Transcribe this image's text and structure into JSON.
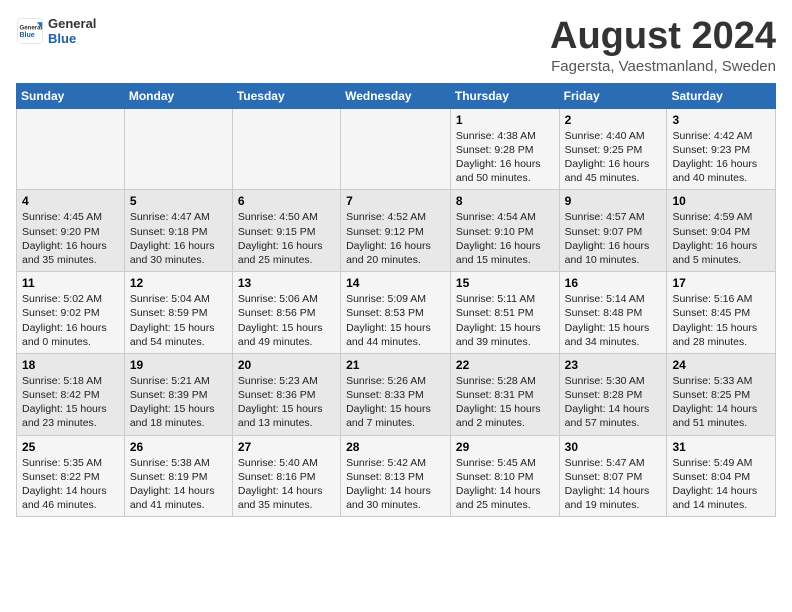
{
  "header": {
    "logo_general": "General",
    "logo_blue": "Blue",
    "title": "August 2024",
    "subtitle": "Fagersta, Vaestmanland, Sweden"
  },
  "days_of_week": [
    "Sunday",
    "Monday",
    "Tuesday",
    "Wednesday",
    "Thursday",
    "Friday",
    "Saturday"
  ],
  "weeks": [
    [
      {
        "day": "",
        "info": ""
      },
      {
        "day": "",
        "info": ""
      },
      {
        "day": "",
        "info": ""
      },
      {
        "day": "",
        "info": ""
      },
      {
        "day": "1",
        "info": "Sunrise: 4:38 AM\nSunset: 9:28 PM\nDaylight: 16 hours\nand 50 minutes."
      },
      {
        "day": "2",
        "info": "Sunrise: 4:40 AM\nSunset: 9:25 PM\nDaylight: 16 hours\nand 45 minutes."
      },
      {
        "day": "3",
        "info": "Sunrise: 4:42 AM\nSunset: 9:23 PM\nDaylight: 16 hours\nand 40 minutes."
      }
    ],
    [
      {
        "day": "4",
        "info": "Sunrise: 4:45 AM\nSunset: 9:20 PM\nDaylight: 16 hours\nand 35 minutes."
      },
      {
        "day": "5",
        "info": "Sunrise: 4:47 AM\nSunset: 9:18 PM\nDaylight: 16 hours\nand 30 minutes."
      },
      {
        "day": "6",
        "info": "Sunrise: 4:50 AM\nSunset: 9:15 PM\nDaylight: 16 hours\nand 25 minutes."
      },
      {
        "day": "7",
        "info": "Sunrise: 4:52 AM\nSunset: 9:12 PM\nDaylight: 16 hours\nand 20 minutes."
      },
      {
        "day": "8",
        "info": "Sunrise: 4:54 AM\nSunset: 9:10 PM\nDaylight: 16 hours\nand 15 minutes."
      },
      {
        "day": "9",
        "info": "Sunrise: 4:57 AM\nSunset: 9:07 PM\nDaylight: 16 hours\nand 10 minutes."
      },
      {
        "day": "10",
        "info": "Sunrise: 4:59 AM\nSunset: 9:04 PM\nDaylight: 16 hours\nand 5 minutes."
      }
    ],
    [
      {
        "day": "11",
        "info": "Sunrise: 5:02 AM\nSunset: 9:02 PM\nDaylight: 16 hours\nand 0 minutes."
      },
      {
        "day": "12",
        "info": "Sunrise: 5:04 AM\nSunset: 8:59 PM\nDaylight: 15 hours\nand 54 minutes."
      },
      {
        "day": "13",
        "info": "Sunrise: 5:06 AM\nSunset: 8:56 PM\nDaylight: 15 hours\nand 49 minutes."
      },
      {
        "day": "14",
        "info": "Sunrise: 5:09 AM\nSunset: 8:53 PM\nDaylight: 15 hours\nand 44 minutes."
      },
      {
        "day": "15",
        "info": "Sunrise: 5:11 AM\nSunset: 8:51 PM\nDaylight: 15 hours\nand 39 minutes."
      },
      {
        "day": "16",
        "info": "Sunrise: 5:14 AM\nSunset: 8:48 PM\nDaylight: 15 hours\nand 34 minutes."
      },
      {
        "day": "17",
        "info": "Sunrise: 5:16 AM\nSunset: 8:45 PM\nDaylight: 15 hours\nand 28 minutes."
      }
    ],
    [
      {
        "day": "18",
        "info": "Sunrise: 5:18 AM\nSunset: 8:42 PM\nDaylight: 15 hours\nand 23 minutes."
      },
      {
        "day": "19",
        "info": "Sunrise: 5:21 AM\nSunset: 8:39 PM\nDaylight: 15 hours\nand 18 minutes."
      },
      {
        "day": "20",
        "info": "Sunrise: 5:23 AM\nSunset: 8:36 PM\nDaylight: 15 hours\nand 13 minutes."
      },
      {
        "day": "21",
        "info": "Sunrise: 5:26 AM\nSunset: 8:33 PM\nDaylight: 15 hours\nand 7 minutes."
      },
      {
        "day": "22",
        "info": "Sunrise: 5:28 AM\nSunset: 8:31 PM\nDaylight: 15 hours\nand 2 minutes."
      },
      {
        "day": "23",
        "info": "Sunrise: 5:30 AM\nSunset: 8:28 PM\nDaylight: 14 hours\nand 57 minutes."
      },
      {
        "day": "24",
        "info": "Sunrise: 5:33 AM\nSunset: 8:25 PM\nDaylight: 14 hours\nand 51 minutes."
      }
    ],
    [
      {
        "day": "25",
        "info": "Sunrise: 5:35 AM\nSunset: 8:22 PM\nDaylight: 14 hours\nand 46 minutes."
      },
      {
        "day": "26",
        "info": "Sunrise: 5:38 AM\nSunset: 8:19 PM\nDaylight: 14 hours\nand 41 minutes."
      },
      {
        "day": "27",
        "info": "Sunrise: 5:40 AM\nSunset: 8:16 PM\nDaylight: 14 hours\nand 35 minutes."
      },
      {
        "day": "28",
        "info": "Sunrise: 5:42 AM\nSunset: 8:13 PM\nDaylight: 14 hours\nand 30 minutes."
      },
      {
        "day": "29",
        "info": "Sunrise: 5:45 AM\nSunset: 8:10 PM\nDaylight: 14 hours\nand 25 minutes."
      },
      {
        "day": "30",
        "info": "Sunrise: 5:47 AM\nSunset: 8:07 PM\nDaylight: 14 hours\nand 19 minutes."
      },
      {
        "day": "31",
        "info": "Sunrise: 5:49 AM\nSunset: 8:04 PM\nDaylight: 14 hours\nand 14 minutes."
      }
    ]
  ]
}
